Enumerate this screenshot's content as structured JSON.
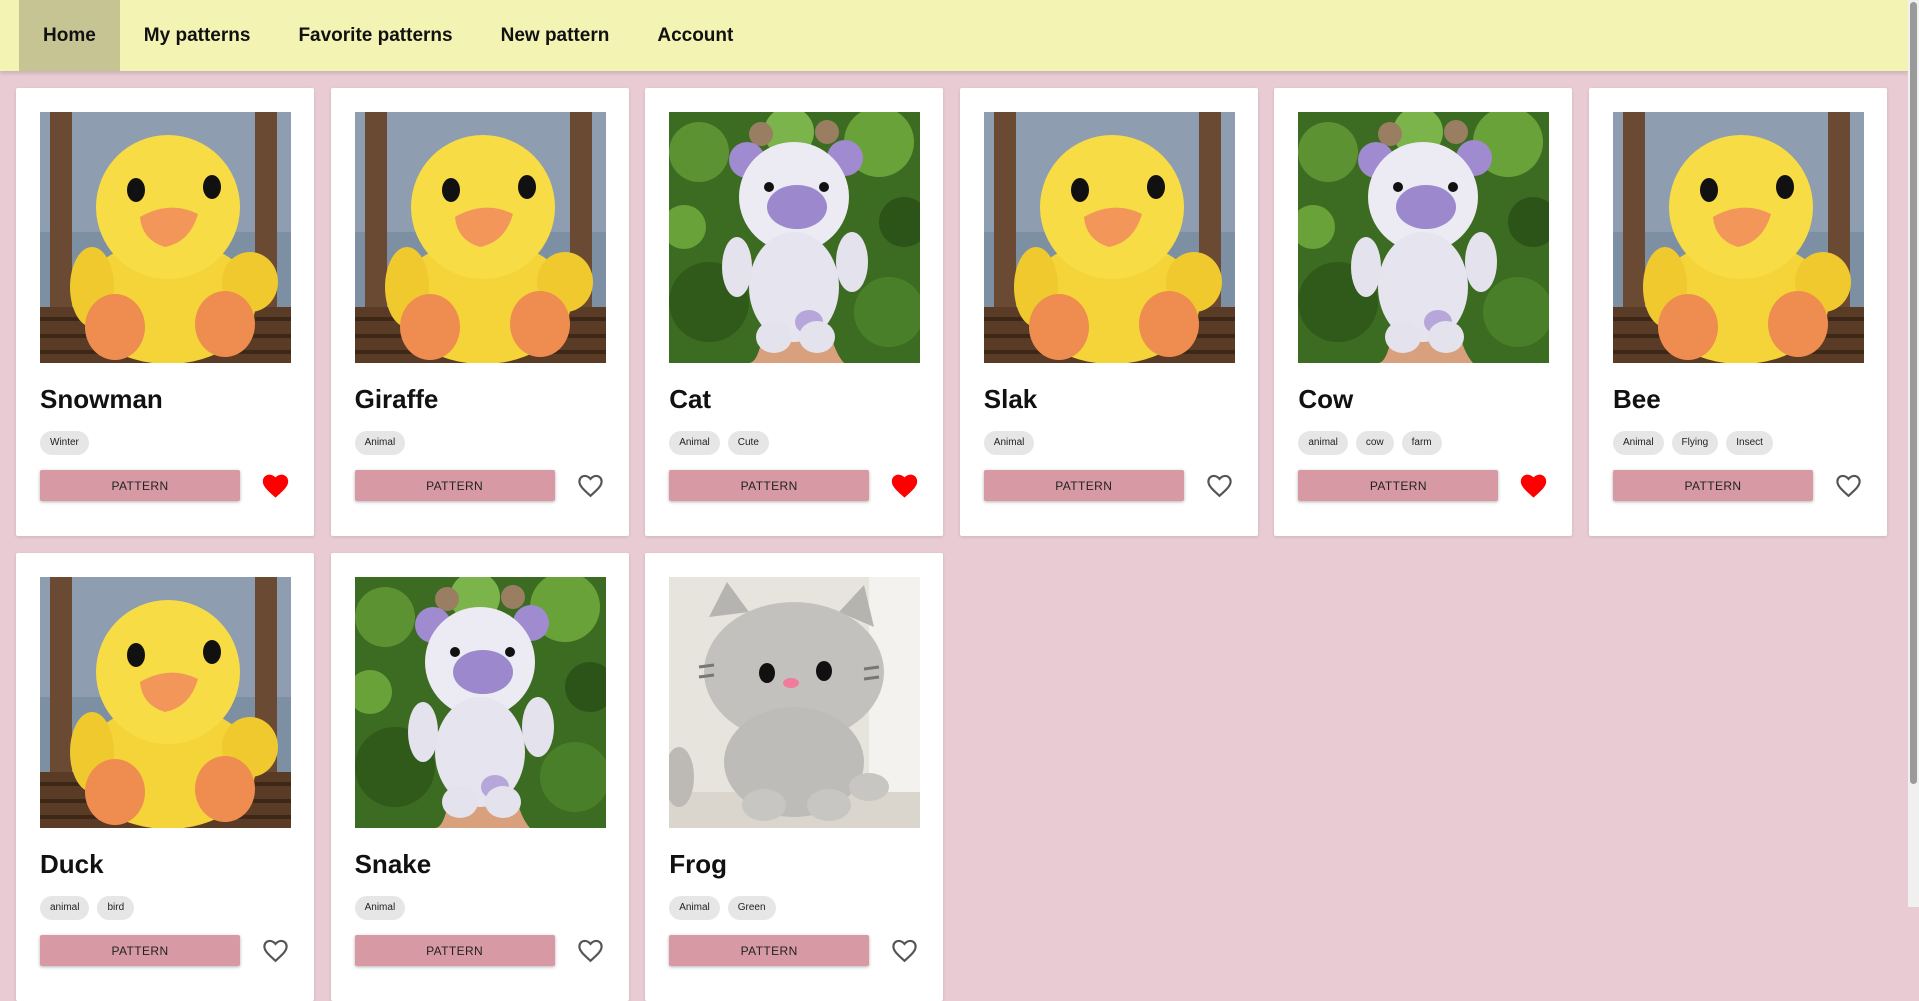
{
  "nav": {
    "items": [
      {
        "label": "Home",
        "active": true
      },
      {
        "label": "My patterns",
        "active": false
      },
      {
        "label": "Favorite patterns",
        "active": false
      },
      {
        "label": "New pattern",
        "active": false
      },
      {
        "label": "Account",
        "active": false
      }
    ]
  },
  "colors": {
    "page_background": "#e9cbd3",
    "nav_background": "#f3f3b3",
    "nav_active": "#c6c493",
    "button": "#d79aa4",
    "heart_filled": "#ff0000",
    "heart_outline": "#555555"
  },
  "cards": [
    {
      "title": "Snowman",
      "image": "duck-plush-photo",
      "tags": [
        "Winter"
      ],
      "button_label": "PATTERN",
      "favorited": true
    },
    {
      "title": "Giraffe",
      "image": "duck-plush-photo",
      "tags": [
        "Animal"
      ],
      "button_label": "PATTERN",
      "favorited": false
    },
    {
      "title": "Cat",
      "image": "cow-plush-photo",
      "tags": [
        "Animal",
        "Cute"
      ],
      "button_label": "PATTERN",
      "favorited": true
    },
    {
      "title": "Slak",
      "image": "duck-plush-photo",
      "tags": [
        "Animal"
      ],
      "button_label": "PATTERN",
      "favorited": false
    },
    {
      "title": "Cow",
      "image": "cow-plush-photo",
      "tags": [
        "animal",
        "cow",
        "farm"
      ],
      "button_label": "PATTERN",
      "favorited": true
    },
    {
      "title": "Bee",
      "image": "duck-plush-photo",
      "tags": [
        "Animal",
        "Flying",
        "Insect"
      ],
      "button_label": "PATTERN",
      "favorited": false
    },
    {
      "title": "Duck",
      "image": "duck-plush-photo",
      "tags": [
        "animal",
        "bird"
      ],
      "button_label": "PATTERN",
      "favorited": false
    },
    {
      "title": "Snake",
      "image": "cow-plush-photo",
      "tags": [
        "Animal"
      ],
      "button_label": "PATTERN",
      "favorited": false
    },
    {
      "title": "Frog",
      "image": "cat-plush-photo",
      "tags": [
        "Animal",
        "Green"
      ],
      "button_label": "PATTERN",
      "favorited": false
    }
  ]
}
